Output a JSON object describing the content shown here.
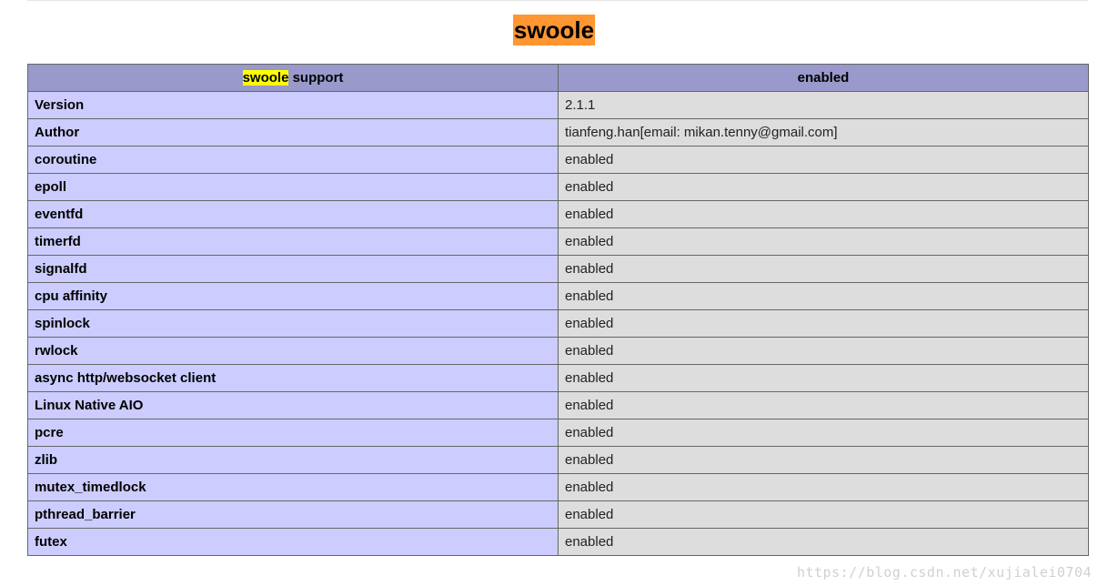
{
  "page": {
    "heading": "swoole"
  },
  "table": {
    "header": {
      "left_highlight": "swoole",
      "left_rest": " support",
      "right": "enabled"
    },
    "rows": [
      {
        "key": "Version",
        "value": "2.1.1"
      },
      {
        "key": "Author",
        "value": "tianfeng.han[email: mikan.tenny@gmail.com]"
      },
      {
        "key": "coroutine",
        "value": "enabled"
      },
      {
        "key": "epoll",
        "value": "enabled"
      },
      {
        "key": "eventfd",
        "value": "enabled"
      },
      {
        "key": "timerfd",
        "value": "enabled"
      },
      {
        "key": "signalfd",
        "value": "enabled"
      },
      {
        "key": "cpu affinity",
        "value": "enabled"
      },
      {
        "key": "spinlock",
        "value": "enabled"
      },
      {
        "key": "rwlock",
        "value": "enabled"
      },
      {
        "key": "async http/websocket client",
        "value": "enabled"
      },
      {
        "key": "Linux Native AIO",
        "value": "enabled"
      },
      {
        "key": "pcre",
        "value": "enabled"
      },
      {
        "key": "zlib",
        "value": "enabled"
      },
      {
        "key": "mutex_timedlock",
        "value": "enabled"
      },
      {
        "key": "pthread_barrier",
        "value": "enabled"
      },
      {
        "key": "futex",
        "value": "enabled"
      }
    ]
  },
  "watermark": "https://blog.csdn.net/xujialei0704",
  "colors": {
    "heading_highlight": "#ff9632",
    "search_highlight": "#ffff00",
    "header_bg": "#9999cc",
    "key_bg": "#ccccff",
    "value_bg": "#dddddd"
  }
}
